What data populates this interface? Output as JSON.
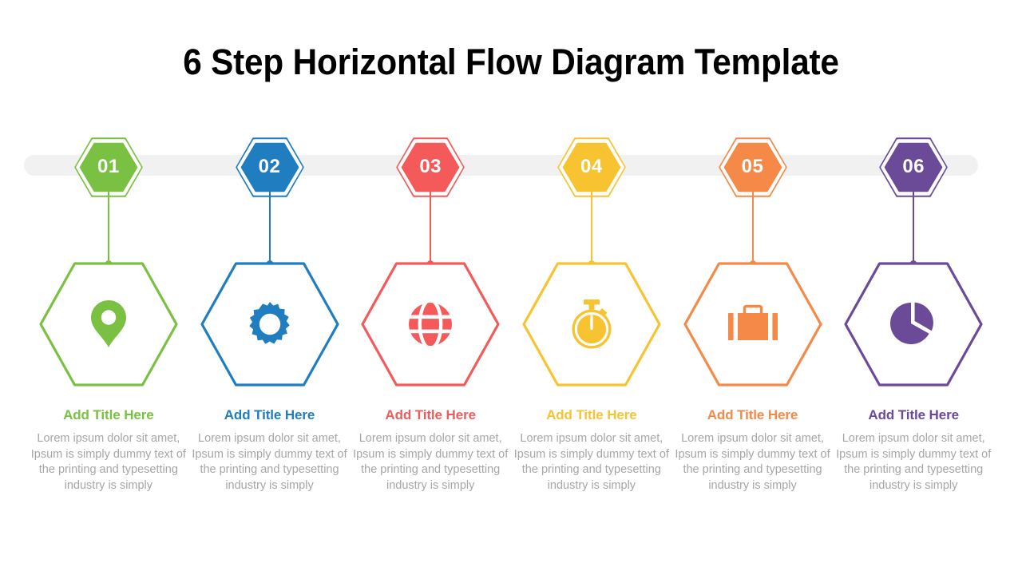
{
  "slide": {
    "title": "6 Step Horizontal Flow Diagram Template",
    "background": "#ffffff",
    "track_color": "#f1f1f1",
    "body_text_color": "#a6a6a6"
  },
  "steps": [
    {
      "number": "01",
      "color": "#7ac143",
      "icon": "map-pin-icon",
      "title": "Add Title Here",
      "body": "Lorem ipsum dolor sit amet, Ipsum is simply dummy text of the printing and typesetting industry is simply"
    },
    {
      "number": "02",
      "color": "#1f7dc0",
      "icon": "gear-icon",
      "title": "Add Title Here",
      "body": "Lorem ipsum dolor sit amet, Ipsum is simply dummy text of the printing and typesetting industry is simply"
    },
    {
      "number": "03",
      "color": "#f45a5a",
      "icon": "globe-icon",
      "title": "Add Title Here",
      "body": "Lorem ipsum dolor sit amet, Ipsum is simply dummy text of the printing and typesetting industry is simply"
    },
    {
      "number": "04",
      "color": "#f7c331",
      "icon": "stopwatch-icon",
      "title": "Add Title Here",
      "body": "Lorem ipsum dolor sit amet, Ipsum is simply dummy text of the printing and typesetting industry is simply"
    },
    {
      "number": "05",
      "color": "#f58a48",
      "icon": "briefcase-icon",
      "title": "Add Title Here",
      "body": "Lorem ipsum dolor sit amet, Ipsum is simply dummy text of the printing and typesetting industry is simply"
    },
    {
      "number": "06",
      "color": "#6b4a97",
      "icon": "pie-chart-icon",
      "title": "Add Title Here",
      "body": "Lorem ipsum dolor sit amet, Ipsum is simply dummy text of the printing and typesetting industry is simply"
    }
  ]
}
